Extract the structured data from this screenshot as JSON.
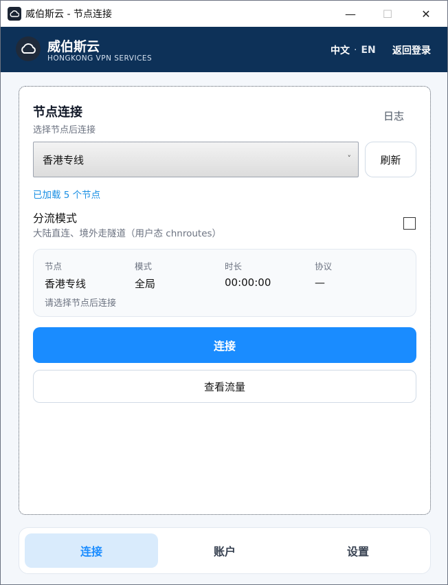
{
  "window": {
    "title": "威伯斯云 - 节点连接",
    "controls": {
      "minimize": "—",
      "maximize": "☐",
      "close": "✕"
    }
  },
  "header": {
    "brand_name": "威伯斯云",
    "brand_subtitle": "HONGKONG VPN SERVICES",
    "lang_zh": "中文",
    "lang_sep": "·",
    "lang_en": "EN",
    "back_login": "返回登录"
  },
  "node_panel": {
    "title": "节点连接",
    "subtitle": "选择节点后连接",
    "log_link": "日志",
    "select": {
      "selected": "香港专线",
      "chevron": "˅"
    },
    "refresh_label": "刷新",
    "loaded_text": "已加载 5 个节点",
    "split_mode": {
      "title": "分流模式",
      "description": "大陆直连、境外走隧道（用户态 chnroutes）",
      "checked": false
    },
    "status": {
      "node_key": "节点",
      "node_val": "香港专线",
      "mode_key": "模式",
      "mode_val": "全局",
      "duration_key": "时长",
      "duration_val": "00:00:00",
      "protocol_key": "协议",
      "protocol_val": "—",
      "hint": "请选择节点后连接"
    },
    "connect_label": "连接",
    "traffic_label": "查看流量"
  },
  "bottom_nav": {
    "items": [
      {
        "label": "连接",
        "active": true
      },
      {
        "label": "账户",
        "active": false
      },
      {
        "label": "设置",
        "active": false
      }
    ]
  },
  "colors": {
    "header_bg": "#0d3158",
    "accent": "#1a8cff",
    "link": "#1a8fe3",
    "nav_active_bg": "#d9ebfc"
  }
}
